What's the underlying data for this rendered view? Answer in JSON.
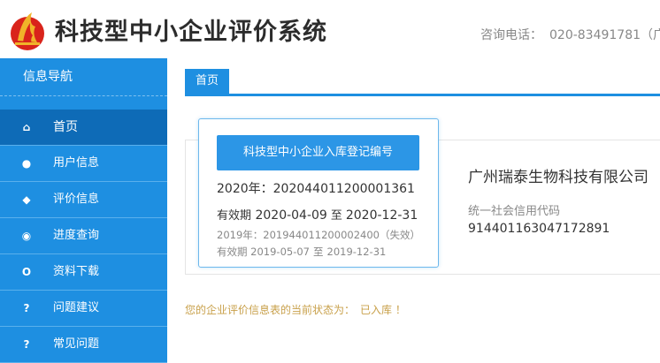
{
  "header": {
    "title": "科技型中小企业评价系统",
    "hotline_label": "咨询电话：",
    "hotline_number": "020-83491781（广"
  },
  "sidebar": {
    "title": "信息导航",
    "items": [
      {
        "label": "首页",
        "icon": "home-icon",
        "glyph": "⌂",
        "active": true
      },
      {
        "label": "用户信息",
        "icon": "user-icon",
        "glyph": "●",
        "active": false
      },
      {
        "label": "评价信息",
        "icon": "tag-icon",
        "glyph": "◆",
        "active": false
      },
      {
        "label": "进度查询",
        "icon": "eye-icon",
        "glyph": "◉",
        "active": false
      },
      {
        "label": "资料下载",
        "icon": "circle-icon",
        "glyph": "O",
        "active": false
      },
      {
        "label": "问题建议",
        "icon": "question-icon",
        "glyph": "?",
        "active": false
      },
      {
        "label": "常见问题",
        "icon": "question-icon",
        "glyph": "?",
        "active": false
      }
    ]
  },
  "tabs": [
    {
      "label": "首页"
    }
  ],
  "card": {
    "button_label": "科技型中小企业入库登记编号",
    "current_line": "2020年：202044011200001361",
    "valid_prefix": "有效期",
    "valid_from": "2020-04-09",
    "valid_mid": "至",
    "valid_to": "2020-12-31",
    "prev_line": "2019年：201944011200002400（失效）",
    "prev_valid_prefix": "有效期",
    "prev_valid_from": "2019-05-07",
    "prev_valid_mid": "至",
    "prev_valid_to": "2019-12-31"
  },
  "company": {
    "name": "广州瑞泰生物科技有限公司",
    "credit_label": "统一社会信用代码",
    "credit_code": "914401163047172891"
  },
  "status": {
    "text": "您的企业评价信息表的当前状态为：",
    "value": "已入库 ！"
  },
  "colors": {
    "primary": "#1e8fe1",
    "active_nav": "#0e6bb7",
    "status_text": "#c8a04a",
    "logo_red": "#d9241b",
    "logo_gold": "#f0b429"
  }
}
